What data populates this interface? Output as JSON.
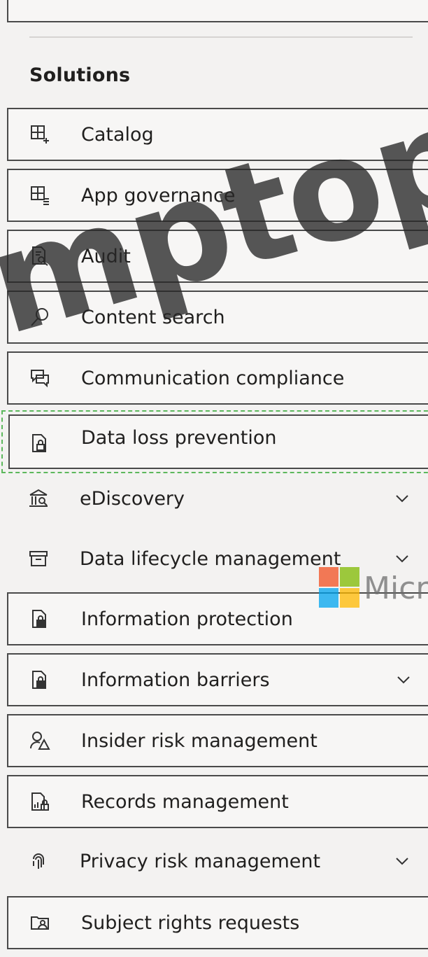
{
  "section": {
    "label": "Solutions"
  },
  "items": [
    {
      "label": "Catalog",
      "icon": "catalog-icon",
      "expandable": false
    },
    {
      "label": "App governance",
      "icon": "app-governance-icon",
      "expandable": false
    },
    {
      "label": "Audit",
      "icon": "audit-icon",
      "expandable": false
    },
    {
      "label": "Content search",
      "icon": "search-icon",
      "expandable": false
    },
    {
      "label": "Communication compliance",
      "icon": "chat-icon",
      "expandable": false
    },
    {
      "label": "Data loss prevention",
      "icon": "dlp-icon",
      "expandable": false,
      "highlighted": true
    },
    {
      "label": "eDiscovery",
      "icon": "ediscovery-icon",
      "expandable": true
    },
    {
      "label": "Data lifecycle management",
      "icon": "archive-icon",
      "expandable": true
    },
    {
      "label": "Information protection",
      "icon": "info-protection-icon",
      "expandable": false
    },
    {
      "label": "Information barriers",
      "icon": "info-barriers-icon",
      "expandable": true
    },
    {
      "label": "Insider risk management",
      "icon": "insider-risk-icon",
      "expandable": false
    },
    {
      "label": "Records management",
      "icon": "records-icon",
      "expandable": false
    },
    {
      "label": "Privacy risk management",
      "icon": "fingerprint-icon",
      "expandable": true
    },
    {
      "label": "Subject rights requests",
      "icon": "subject-rights-icon",
      "expandable": false
    }
  ],
  "watermark": {
    "text": "mptop.c",
    "logo_text": "Micr"
  },
  "colors": {
    "highlight_border": "#5cb85c",
    "item_border": "#4a4a4a",
    "background": "#f3f2f1"
  }
}
